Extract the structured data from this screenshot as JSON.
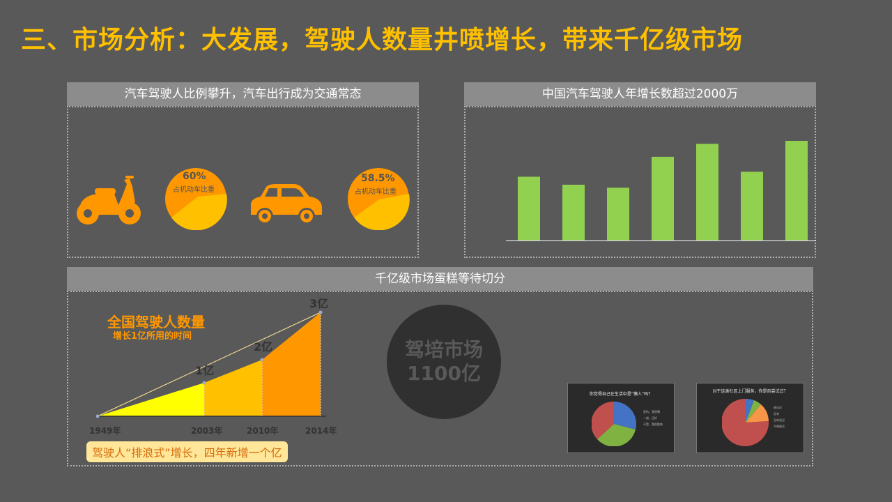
{
  "page_title": "三、市场分析：大发展，驾驶人数量井喷增长，带来千亿级市场",
  "panel_left": {
    "header": "汽车驾驶人比例攀升，汽车出行成为交通常态",
    "pie1": {
      "percent": "60%",
      "label": "占机动车比重"
    },
    "pie2": {
      "percent": "58.5%",
      "label": "占机动车比重"
    }
  },
  "panel_right": {
    "header": "中国汽车驾驶人年增长数超过2000万"
  },
  "chart_data": {
    "type": "bar",
    "categories": [
      "",
      "",
      "",
      "",
      "",
      "",
      ""
    ],
    "values": [
      0.64,
      0.56,
      0.53,
      0.84,
      0.97,
      0.69,
      1.0
    ],
    "title": "中国汽车驾驶人年增长数超过2000万",
    "series_color": "#92D050"
  },
  "panel_bottom": {
    "header": "千亿级市场蛋糕等待切分",
    "growth_title": "全国驾驶人数量",
    "growth_subtitle": "增长1亿所用的时间",
    "years": [
      "1949年",
      "2003年",
      "2010年",
      "2014年"
    ],
    "levels": [
      "1亿",
      "2亿",
      "3亿"
    ],
    "callout": "驾驶人“排浪式”增长，四年新增一个亿",
    "market_name": "驾培市场",
    "market_value": "1100亿",
    "thumb1": {
      "title": "你觉得自己在生活中是“懒人”吗？",
      "legend": [
        "是的，我很懒",
        "一般，还好",
        "不是，我很勤快"
      ]
    },
    "thumb2": {
      "title": "对于这类社区上门服务，你是否尝试过？",
      "legend": [
        "尝试过",
        "没有",
        "没听说过",
        "不想尝试"
      ]
    }
  },
  "colors": {
    "accent": "#FFC000",
    "orange": "#FF9800",
    "green": "#92D050",
    "bg": "#595959"
  }
}
